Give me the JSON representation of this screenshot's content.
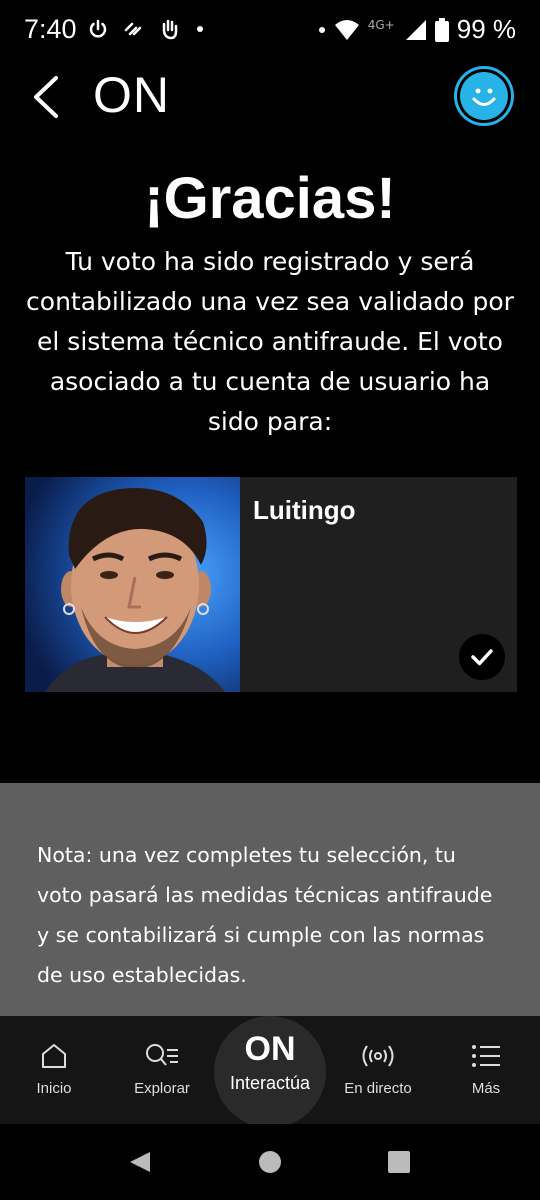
{
  "status_bar": {
    "time": "7:40",
    "network": "4G+",
    "battery": "99 %"
  },
  "header": {
    "brand": "ON"
  },
  "thanks": {
    "title": "¡Gracias!",
    "body": "Tu voto ha sido registrado y será contabilizado una vez sea validado por el sistema técnico antifraude. El voto asociado a tu cuenta de usuario ha sido para:"
  },
  "candidate": {
    "name": "Luitingo",
    "selected": true
  },
  "note": {
    "text": "Nota: una vez completes tu selección, tu voto pasará las medidas técnicas antifraude y se contabilizará si cumple con las normas de uso establecidas."
  },
  "bottom_nav": {
    "items": [
      {
        "label": "Inicio",
        "icon": "home-icon"
      },
      {
        "label": "Explorar",
        "icon": "search-list-icon"
      },
      {
        "label": "Interactúa",
        "icon": "on-logo",
        "logo": "ON",
        "active": true
      },
      {
        "label": "En directo",
        "icon": "broadcast-icon"
      },
      {
        "label": "Más",
        "icon": "menu-icon"
      }
    ]
  },
  "colors": {
    "accent": "#27b3e8",
    "note_bg": "#5f5f5f",
    "card_bg": "#1f1f1f",
    "nav_bg": "#151515"
  }
}
